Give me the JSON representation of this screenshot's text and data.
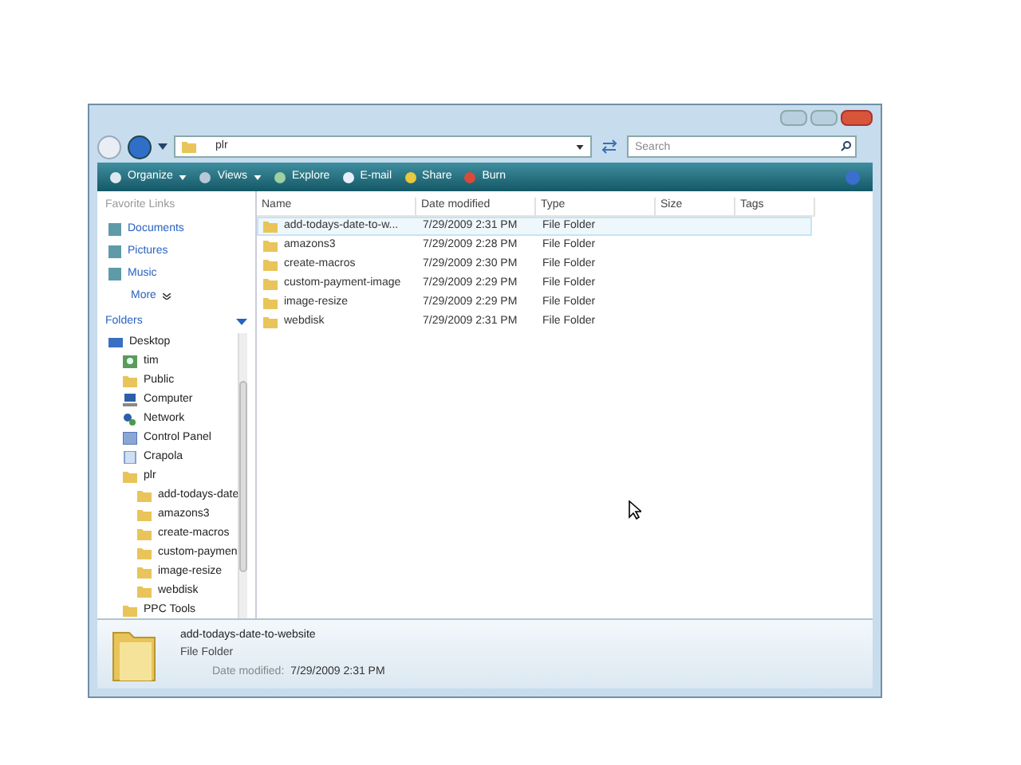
{
  "address_bar": {
    "breadcrumb": [
      "plr"
    ]
  },
  "search": {
    "placeholder": "Search"
  },
  "toolbar": [
    {
      "label": "Organize",
      "dropdown": true
    },
    {
      "label": "Views",
      "dropdown": true
    },
    {
      "label": "Explore",
      "dropdown": false
    },
    {
      "label": "E-mail",
      "dropdown": false
    },
    {
      "label": "Share",
      "dropdown": false
    },
    {
      "label": "Burn",
      "dropdown": false
    }
  ],
  "sidebar": {
    "favorite_links_title": "Favorite Links",
    "favorite_links": [
      "Documents",
      "Pictures",
      "Music"
    ],
    "more": "More",
    "folders_title": "Folders",
    "tree": [
      {
        "label": "Desktop",
        "kind": "desktop",
        "children": [
          {
            "label": "tim",
            "kind": "user"
          },
          {
            "label": "Public",
            "kind": "folder"
          },
          {
            "label": "Computer",
            "kind": "computer"
          },
          {
            "label": "Network",
            "kind": "network"
          },
          {
            "label": "Control Panel",
            "kind": "panel"
          },
          {
            "label": "Crapola",
            "kind": "document"
          },
          {
            "label": "plr",
            "kind": "folder",
            "children": [
              {
                "label": "add-todays-date",
                "kind": "folder"
              },
              {
                "label": "amazons3",
                "kind": "folder"
              },
              {
                "label": "create-macros",
                "kind": "folder"
              },
              {
                "label": "custom-paymen",
                "kind": "folder"
              },
              {
                "label": "image-resize",
                "kind": "folder"
              },
              {
                "label": "webdisk",
                "kind": "folder"
              }
            ]
          },
          {
            "label": "PPC Tools",
            "kind": "folder"
          }
        ]
      }
    ]
  },
  "file_list": {
    "columns": [
      "Name",
      "Date modified",
      "Type",
      "Size",
      "Tags"
    ],
    "rows": [
      {
        "name": "add-todays-date-to-w...",
        "date": "7/29/2009 2:31 PM",
        "type": "File Folder",
        "selected": true
      },
      {
        "name": "amazons3",
        "date": "7/29/2009 2:28 PM",
        "type": "File Folder",
        "selected": false
      },
      {
        "name": "create-macros",
        "date": "7/29/2009 2:30 PM",
        "type": "File Folder",
        "selected": false
      },
      {
        "name": "custom-payment-image",
        "date": "7/29/2009 2:29 PM",
        "type": "File Folder",
        "selected": false
      },
      {
        "name": "image-resize",
        "date": "7/29/2009 2:29 PM",
        "type": "File Folder",
        "selected": false
      },
      {
        "name": "webdisk",
        "date": "7/29/2009 2:31 PM",
        "type": "File Folder",
        "selected": false
      }
    ]
  },
  "details": {
    "name": "add-todays-date-to-website",
    "type": "File Folder",
    "date_label": "Date modified:",
    "date_value": "7/29/2009 2:31 PM"
  }
}
